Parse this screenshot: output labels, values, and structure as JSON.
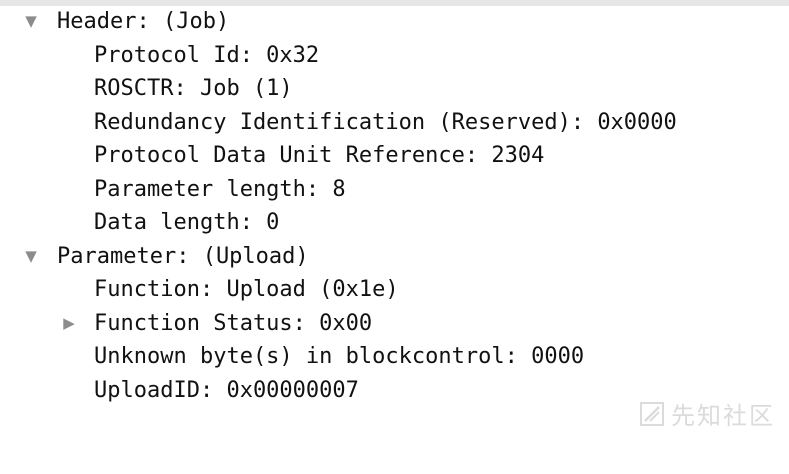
{
  "tree": {
    "header": {
      "label": "Header: (Job)",
      "expand_state": "expanded",
      "children": [
        "Protocol Id: 0x32",
        "ROSCTR: Job (1)",
        "Redundancy Identification (Reserved): 0x0000",
        "Protocol Data Unit Reference: 2304",
        "Parameter length: 8",
        "Data length: 0"
      ]
    },
    "parameter": {
      "label": "Parameter: (Upload)",
      "expand_state": "expanded",
      "children": [
        {
          "label": "Function: Upload (0x1e)"
        },
        {
          "label": "Function Status: 0x00",
          "expand_state": "collapsed"
        },
        {
          "label": "Unknown byte(s) in blockcontrol: 0000"
        },
        {
          "label": "UploadID: 0x00000007"
        }
      ]
    }
  },
  "icons": {
    "expanded": "triangle-down-icon",
    "collapsed": "triangle-right-icon"
  },
  "watermark": {
    "text": "先知社区",
    "logo": "xianzhi-logo-icon"
  },
  "colors": {
    "text": "#111111",
    "arrow": "#8c8c8c",
    "top_strip": "#e6e6e6",
    "watermark": "#cfcfcf"
  }
}
